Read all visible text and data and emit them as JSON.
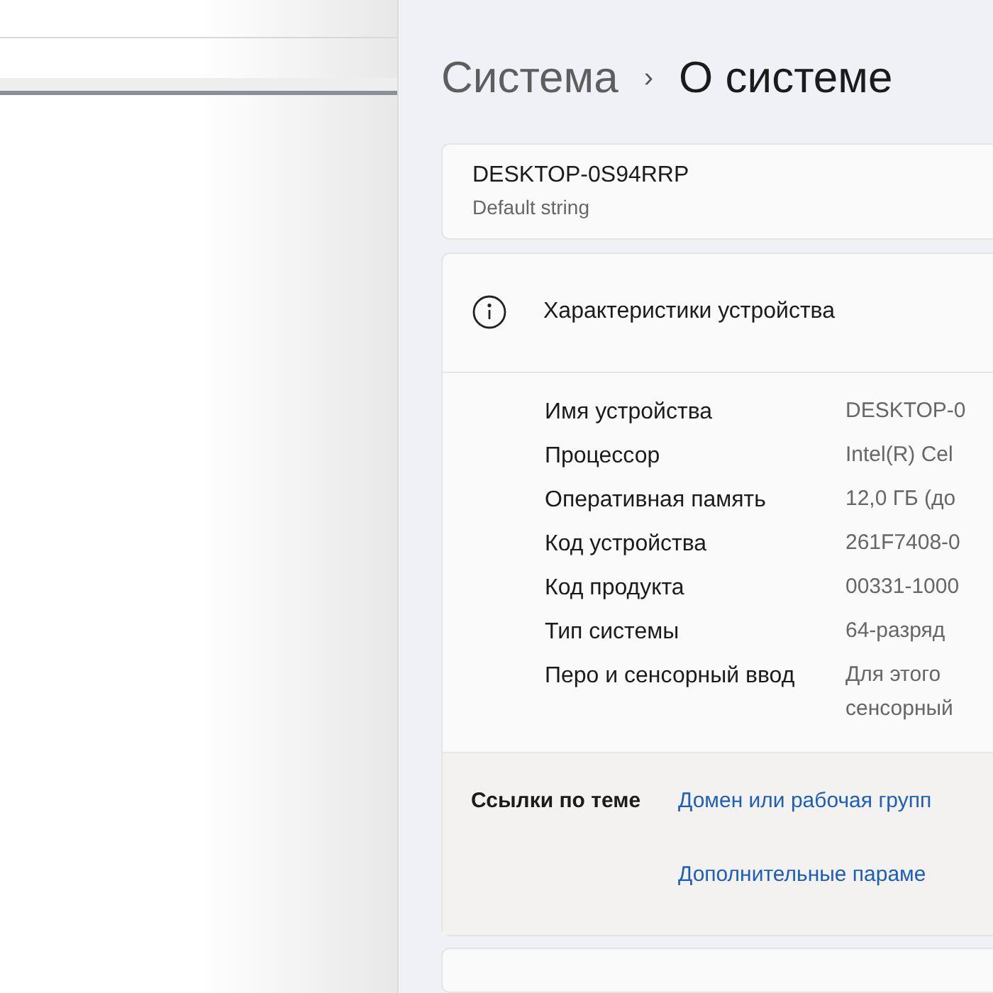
{
  "breadcrumb": {
    "parent": "Система",
    "separator": "›",
    "current": "О системе"
  },
  "device_card": {
    "name": "DESKTOP-0S94RRP",
    "subtitle": "Default string"
  },
  "specs": {
    "title": "Характеристики устройства",
    "rows": [
      {
        "label": "Имя устройства",
        "value": [
          "DESKTOP-0"
        ]
      },
      {
        "label": "Процессор",
        "value": [
          "Intel(R) Cel"
        ]
      },
      {
        "label": "Оперативная память",
        "value": [
          "12,0 ГБ (до"
        ]
      },
      {
        "label": "Код устройства",
        "value": [
          "261F7408-0"
        ]
      },
      {
        "label": "Код продукта",
        "value": [
          "00331-1000"
        ]
      },
      {
        "label": "Тип системы",
        "value": [
          "64-разряд"
        ]
      },
      {
        "label": "Перо и сенсорный ввод",
        "value": [
          "Для этого",
          "сенсорный"
        ]
      }
    ]
  },
  "related": {
    "title": "Ссылки по теме",
    "links": [
      "Домен или рабочая групп",
      "Дополнительные параме"
    ]
  }
}
